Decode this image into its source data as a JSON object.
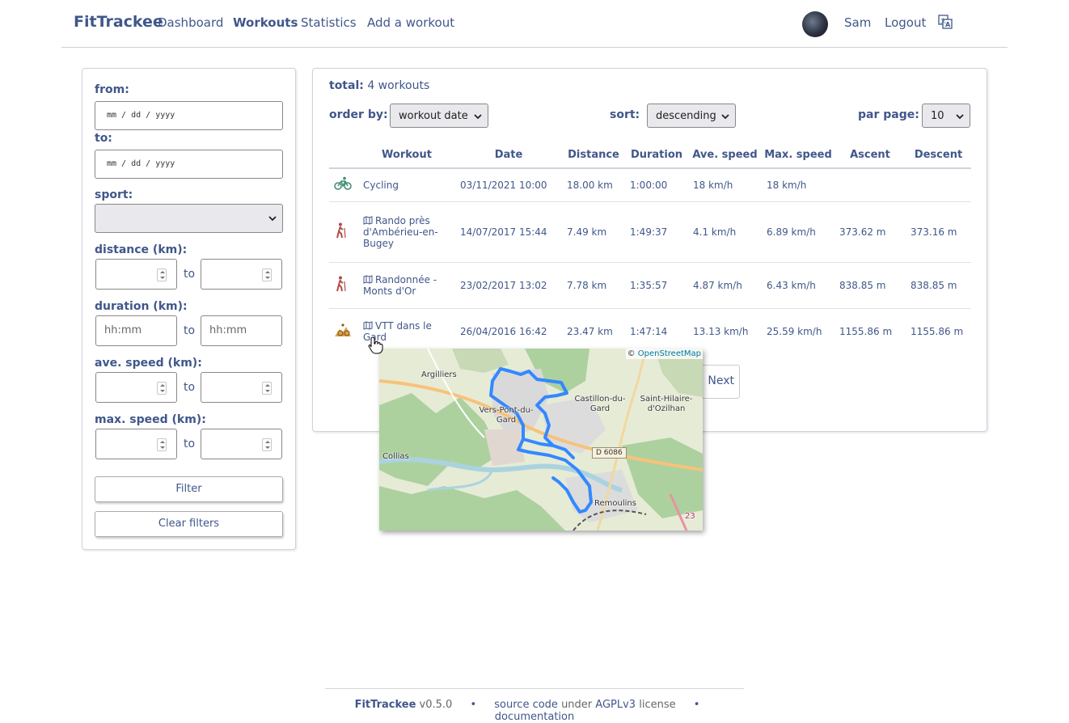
{
  "navbar": {
    "brand": "FitTrackee",
    "links": [
      "Dashboard",
      "Workouts",
      "Statistics",
      "Add a workout"
    ],
    "user": "Sam",
    "logout": "Logout",
    "language_icon": "translate-icon"
  },
  "filters": {
    "from_label": "from:",
    "to_label": "to:",
    "date_placeholder": "mm / dd / yyyy",
    "sport_label": "sport:",
    "distance_label": "distance (km):",
    "duration_label": "duration (km):",
    "ave_speed_label": "ave. speed (km):",
    "max_speed_label": "max. speed (km):",
    "to_text": "to",
    "duration_placeholder": "hh:mm",
    "filter_button": "Filter",
    "clear_button": "Clear filters"
  },
  "workouts": {
    "total_label": "total:",
    "total_value": "4 workouts",
    "order_by_label": "order by:",
    "order_by_value": "workout date",
    "sort_label": "sort:",
    "sort_value": "descending",
    "per_page_label": "par page:",
    "per_page_value": "10",
    "columns": [
      "Workout",
      "Date",
      "Distance",
      "Duration",
      "Ave. speed",
      "Max. speed",
      "Ascent",
      "Descent"
    ],
    "rows": [
      {
        "sport": "cycling-icon",
        "title": "Cycling",
        "date": "03/11/2021 10:00",
        "distance": "18.00 km",
        "duration": "1:00:00",
        "ave_speed": "18 km/h",
        "max_speed": "18 km/h",
        "ascent": "",
        "descent": ""
      },
      {
        "sport": "hiking-icon",
        "title": "Rando près d'Ambérieu-en-Bugey",
        "date": "14/07/2017 15:44",
        "distance": "7.49 km",
        "duration": "1:49:37",
        "ave_speed": "4.1 km/h",
        "max_speed": "6.89 km/h",
        "ascent": "373.62 m",
        "descent": "373.16 m"
      },
      {
        "sport": "hiking-icon",
        "title": "Randonnée - Monts d'Or",
        "date": "23/02/2017 13:02",
        "distance": "7.78 km",
        "duration": "1:35:57",
        "ave_speed": "4.87 km/h",
        "max_speed": "6.43 km/h",
        "ascent": "838.85 m",
        "descent": "838.85 m"
      },
      {
        "sport": "mountain-bike-icon",
        "title": "VTT dans le Gard",
        "date": "26/04/2016 16:42",
        "distance": "23.47 km",
        "duration": "1:47:14",
        "ave_speed": "13.13 km/h",
        "max_speed": "25.59 km/h",
        "ascent": "1155.86 m",
        "descent": "1155.86 m"
      }
    ],
    "pager_next": "Next"
  },
  "map": {
    "attribution_prefix": "©",
    "attribution_link": "OpenStreetMap",
    "labels": [
      "Argilliers",
      "Castillon-du-Gard",
      "Saint-Hilaire-d'Ozilhan",
      "Vers-Pont-du-Gard",
      "Collias",
      "Remoulins"
    ],
    "road_label": "D 6086",
    "road_number": "23"
  },
  "footer": {
    "app": "FitTrackee",
    "version": "v0.5.0",
    "source_code": "source code",
    "under": "under",
    "license_name": "AGPLv3",
    "license": "license",
    "documentation": "documentation"
  },
  "colors": {
    "text": "#40578a",
    "route": "#3388ff",
    "map_forest": "#add19e",
    "map_field": "#e6ebd6"
  }
}
